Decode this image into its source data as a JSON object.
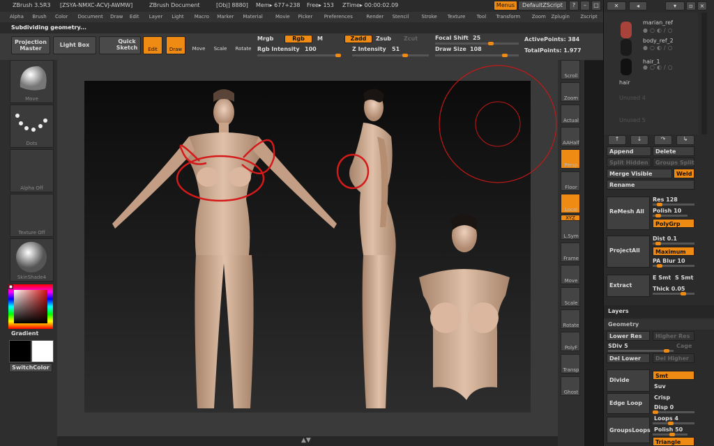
{
  "title_bar": {
    "app": "ZBrush 3.5R3",
    "serial": "[ZSYA-NMXC-ACVJ-AWMW]",
    "document": "ZBrush Document",
    "obj": "[Obj] 8880]",
    "mem": "Mem▸ 677+238",
    "free": "Free▸ 153",
    "ztime": "ZTime▸ 00:00:02.09",
    "menus_label": "Menus",
    "script_label": "DefaultZScript"
  },
  "menu_bar": [
    "Alpha",
    "Brush",
    "Color",
    "Document",
    "Draw",
    "Edit",
    "Layer",
    "Light",
    "Macro",
    "Marker",
    "Material",
    "Movie",
    "Picker",
    "Preferences",
    "Render",
    "Stencil",
    "Stroke",
    "Texture",
    "Tool",
    "Transform",
    "Zoom",
    "Zplugin",
    "Zscript"
  ],
  "status_text": "Subdividing geometry...",
  "toolbar": {
    "projection_master": "Projection Master",
    "light_box": "Light Box",
    "quick_sketch": "Quick Sketch",
    "edit": "Edit",
    "draw": "Draw",
    "move": "Move",
    "scale": "Scale",
    "rotate": "Rotate",
    "mrgb": "Mrgb",
    "rgb": "Rgb",
    "m": "M",
    "zadd": "Zadd",
    "zsub": "Zsub",
    "zcut": "Zcut",
    "rgb_intensity_label": "Rgb Intensity",
    "rgb_intensity": 100,
    "z_intensity_label": "Z Intensity",
    "z_intensity": 51,
    "focal_shift_label": "Focal Shift",
    "focal_shift": 25,
    "draw_size_label": "Draw Size",
    "draw_size": 108,
    "active_points": "ActivePoints: 384",
    "total_points": "TotalPoints: 1.977"
  },
  "left_shelf": {
    "brush": "Move",
    "stroke": "Dots",
    "alpha": "Alpha Off",
    "texture": "Texture Off",
    "material": "SkinShade4",
    "gradient": "Gradient",
    "switch_color": "SwitchColor"
  },
  "right_shelf": [
    "Scroll",
    "Zoom",
    "Actual",
    "AAHalf",
    "Persp",
    "Floor",
    "Local",
    "L.Sym",
    "Frame",
    "Move",
    "Scale",
    "Rotate",
    "PolyF",
    "Transp",
    "Ghost"
  ],
  "right_shelf_xyz": "XYZ",
  "subtools": [
    {
      "name": "marian_ref"
    },
    {
      "name": "body_ref_2"
    },
    {
      "name": "hair_1"
    },
    {
      "name": "hair"
    },
    {
      "name": "Unused 4"
    },
    {
      "name": "Unused 5"
    }
  ],
  "tool_panel": {
    "append": "Append",
    "delete": "Delete",
    "split_hidden": "Split Hidden",
    "groups_split": "Groups Split",
    "merge_visible": "Merge Visible",
    "weld": "Weld",
    "rename": "Rename",
    "remesh_all": "ReMesh All",
    "res": "Res 128",
    "polish": "Polish 10",
    "polygrp": "PolyGrp",
    "project_all": "ProjectAll",
    "dist": "Dist 0.1",
    "maximum": "Maximum",
    "pa_blur": "PA Blur 10",
    "extract": "Extract",
    "e_smt": "E Smt",
    "s_smt": "S Smt",
    "thick": "Thick 0.05",
    "layers": "Layers",
    "geometry": "Geometry",
    "lower_res": "Lower Res",
    "higher_res": "Higher Res",
    "sdiv": "SDiv 5",
    "cage": "Cage",
    "del_lower": "Del Lower",
    "del_higher": "Del Higher",
    "divide": "Divide",
    "smt": "Smt",
    "suv": "Suv",
    "edge_loop": "Edge Loop",
    "crisp": "Crisp",
    "disp": "Disp 0",
    "groups_loops": "GroupsLoops",
    "loops": "Loops 4",
    "polish2": "Polish 50",
    "triangle": "Triangle"
  },
  "colors": {
    "accent": "#ef8a13",
    "annotation": "#d41a1a"
  }
}
